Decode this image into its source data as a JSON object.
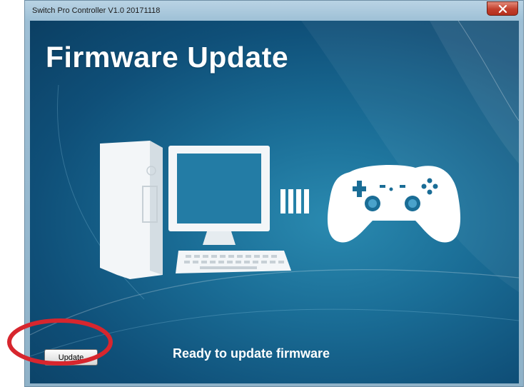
{
  "window": {
    "title": "Switch Pro Controller V1.0 20171118",
    "close_icon": "close-icon"
  },
  "main": {
    "heading": "Firmware Update",
    "status_text": "Ready to update firmware",
    "illustration_icons": [
      "desktop-computer-icon",
      "connection-bars-icon",
      "gamepad-icon"
    ]
  },
  "buttons": {
    "update_label": "Update"
  },
  "colors": {
    "background_dark": "#0b3f63",
    "background_light": "#2a8ab0",
    "text": "#ffffff",
    "highlight_ring": "#d7262e"
  }
}
